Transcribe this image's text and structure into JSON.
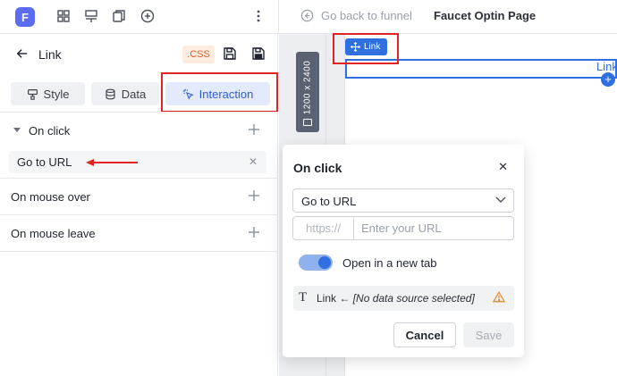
{
  "topbar": {
    "logo_letter": "F",
    "icons": [
      "grid-icon",
      "layout-icon",
      "pages-icon",
      "add-circle-icon",
      "more-vertical-icon"
    ],
    "back_label": "Go back to funnel",
    "page_title": "Faucet Optin Page"
  },
  "panel": {
    "title": "Link",
    "css_label": ".CSS",
    "tabs": [
      {
        "label": "Style",
        "active": false
      },
      {
        "label": "Data",
        "active": false
      },
      {
        "label": "Interaction",
        "active": true
      }
    ],
    "sections": {
      "on_click": "On click",
      "go_to_url": "Go to URL",
      "on_mouse_over": "On mouse over",
      "on_mouse_leave": "On mouse leave"
    }
  },
  "canvas": {
    "size_label": "1200 x 2400",
    "chip_label": "Link",
    "link_text": "Link"
  },
  "popup": {
    "title": "On click",
    "action_value": "Go to URL",
    "url_prefix": "https://",
    "url_placeholder": "Enter your URL",
    "new_tab_label": "Open in a new tab",
    "new_tab_enabled": true,
    "data_source_prefix": "Link ←",
    "data_source_value": "[No data source selected]",
    "cancel_label": "Cancel",
    "save_label": "Save"
  },
  "colors": {
    "accent": "#2f6fe0",
    "annotation_red": "#e02424",
    "css_badge": "#e0612b"
  }
}
